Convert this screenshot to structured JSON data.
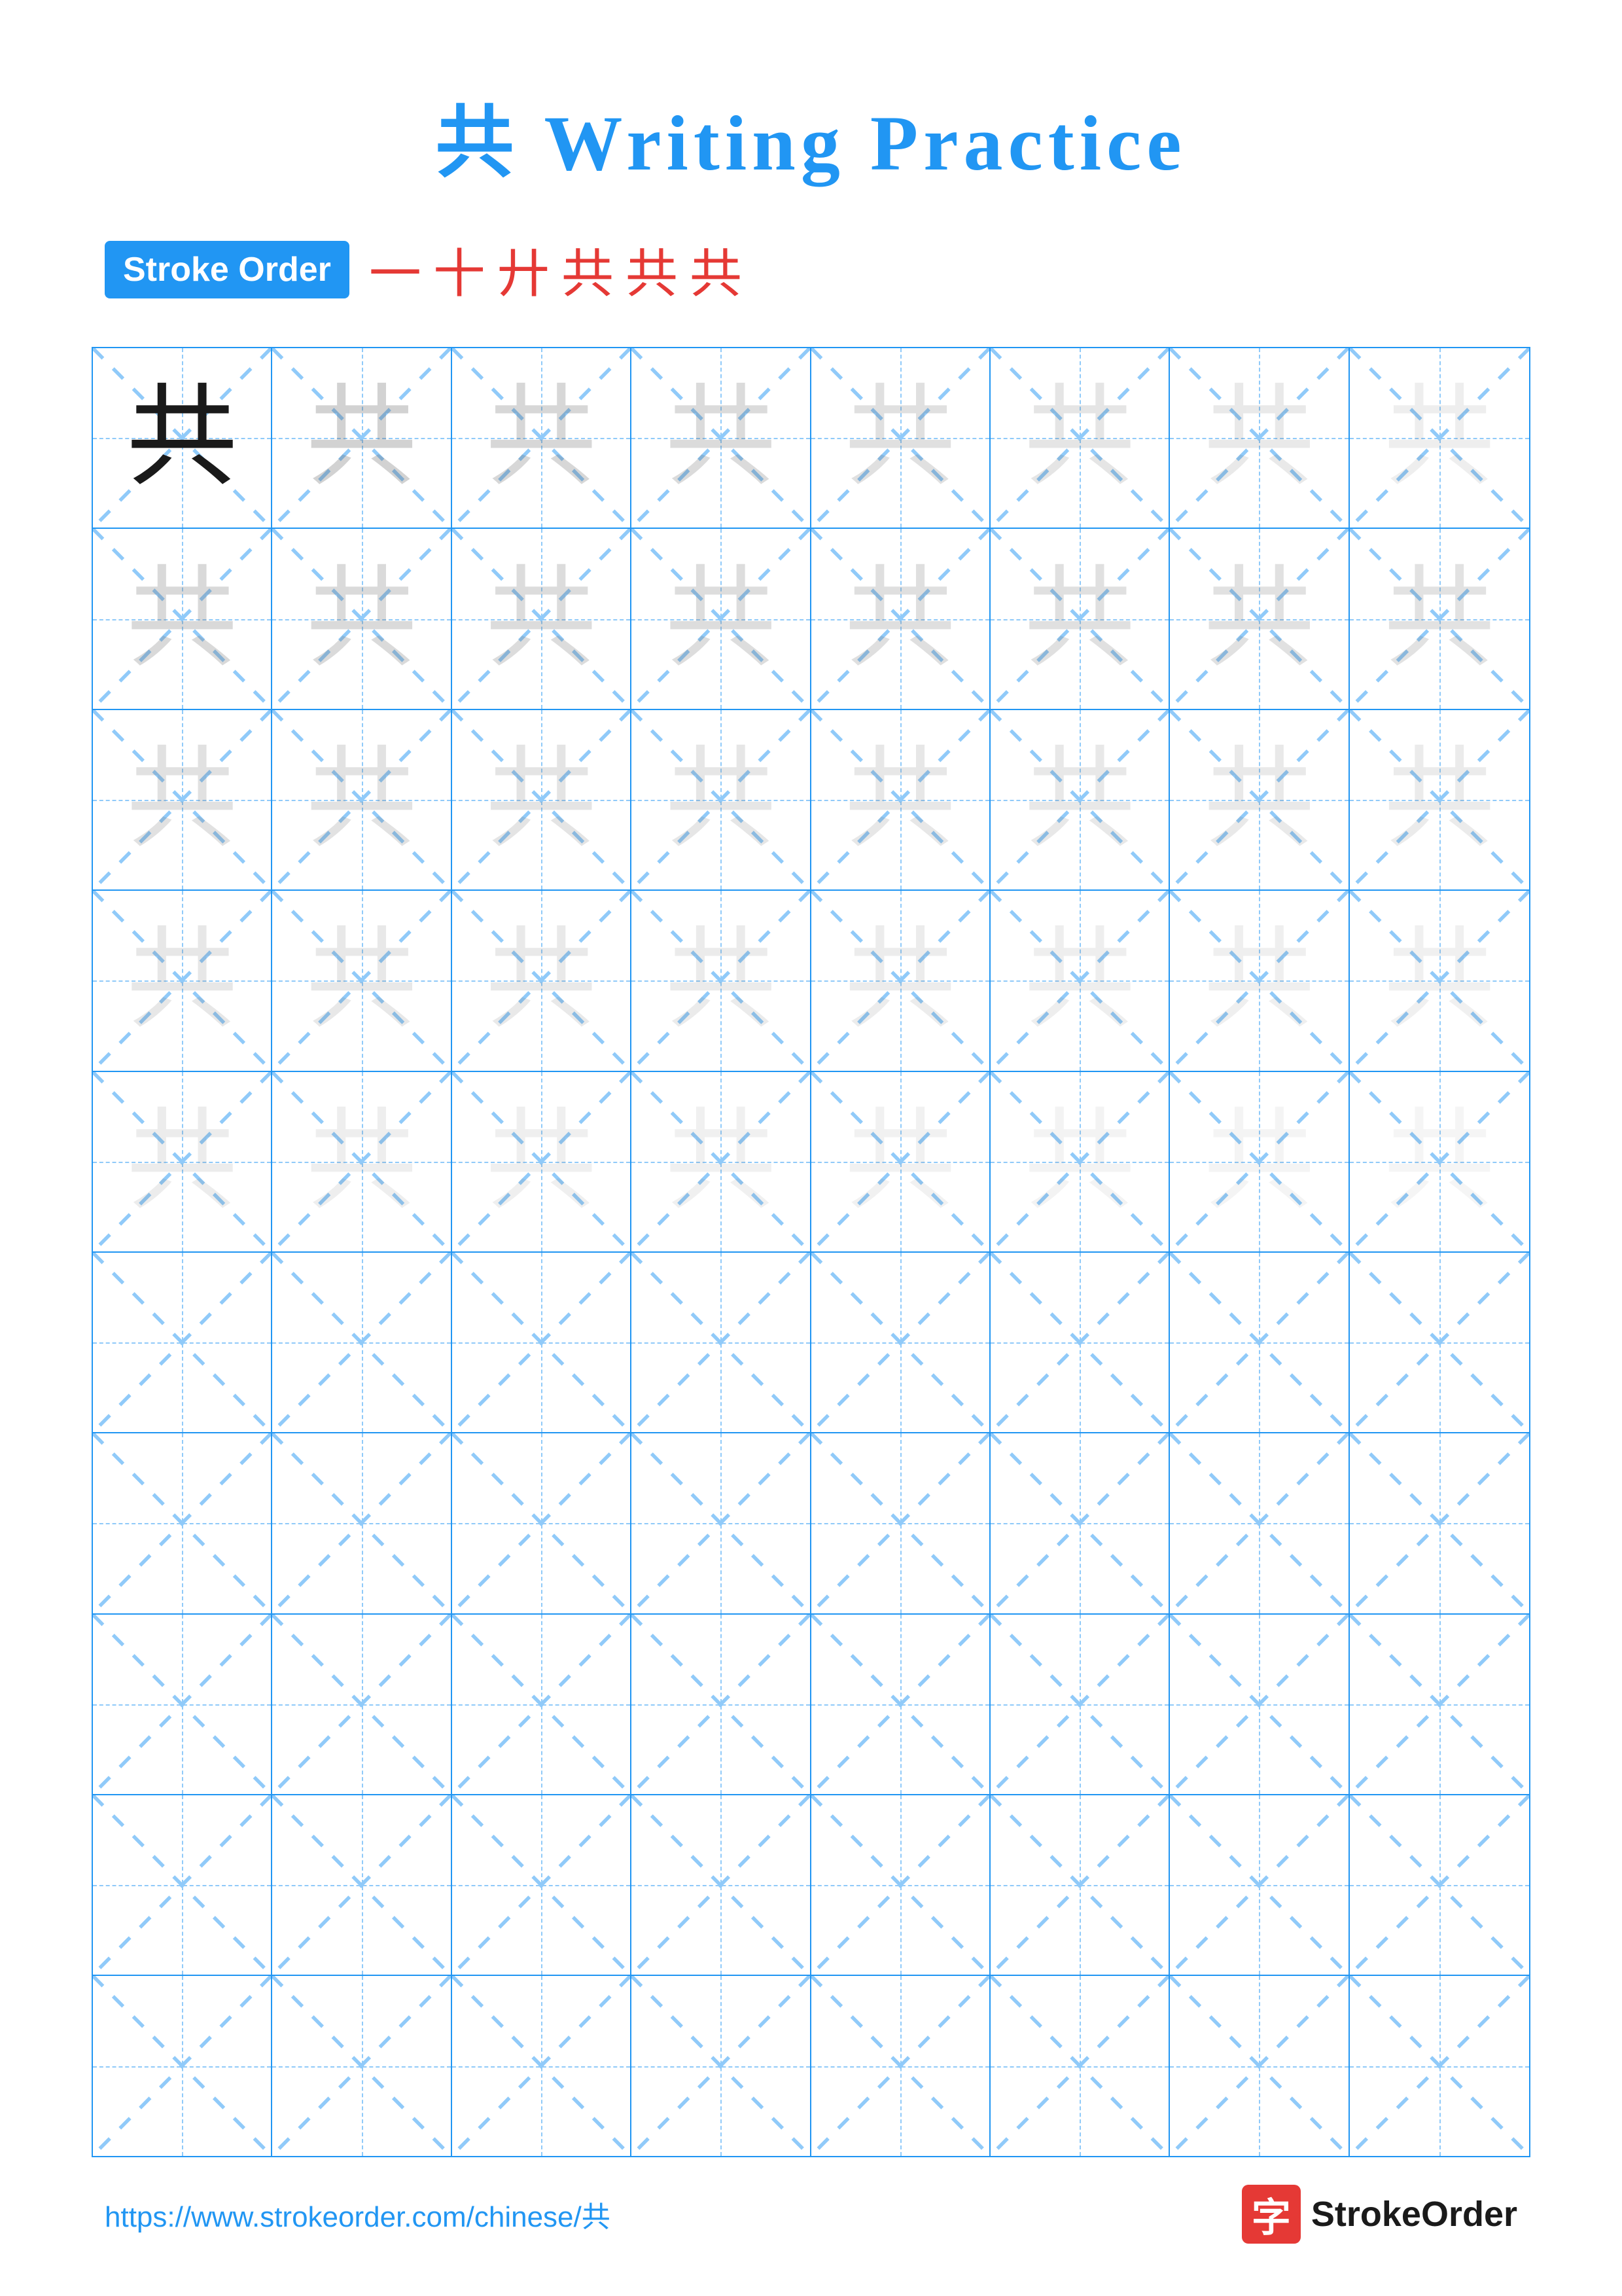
{
  "title": {
    "char": "共",
    "text": "Writing Practice",
    "full": "共 Writing Practice"
  },
  "stroke_order": {
    "badge_label": "Stroke Order",
    "chars": [
      "一",
      "十",
      "廾",
      "共",
      "共",
      "共"
    ]
  },
  "grid": {
    "rows": 10,
    "cols": 8,
    "char": "共",
    "practice_rows": 5,
    "empty_rows": 5
  },
  "footer": {
    "url": "https://www.strokeorder.com/chinese/共",
    "logo_char": "字",
    "logo_text": "StrokeOrder"
  },
  "colors": {
    "blue": "#2196F3",
    "red": "#e53935",
    "grid_line": "#2196F3",
    "guide_line": "#90CAF9"
  }
}
